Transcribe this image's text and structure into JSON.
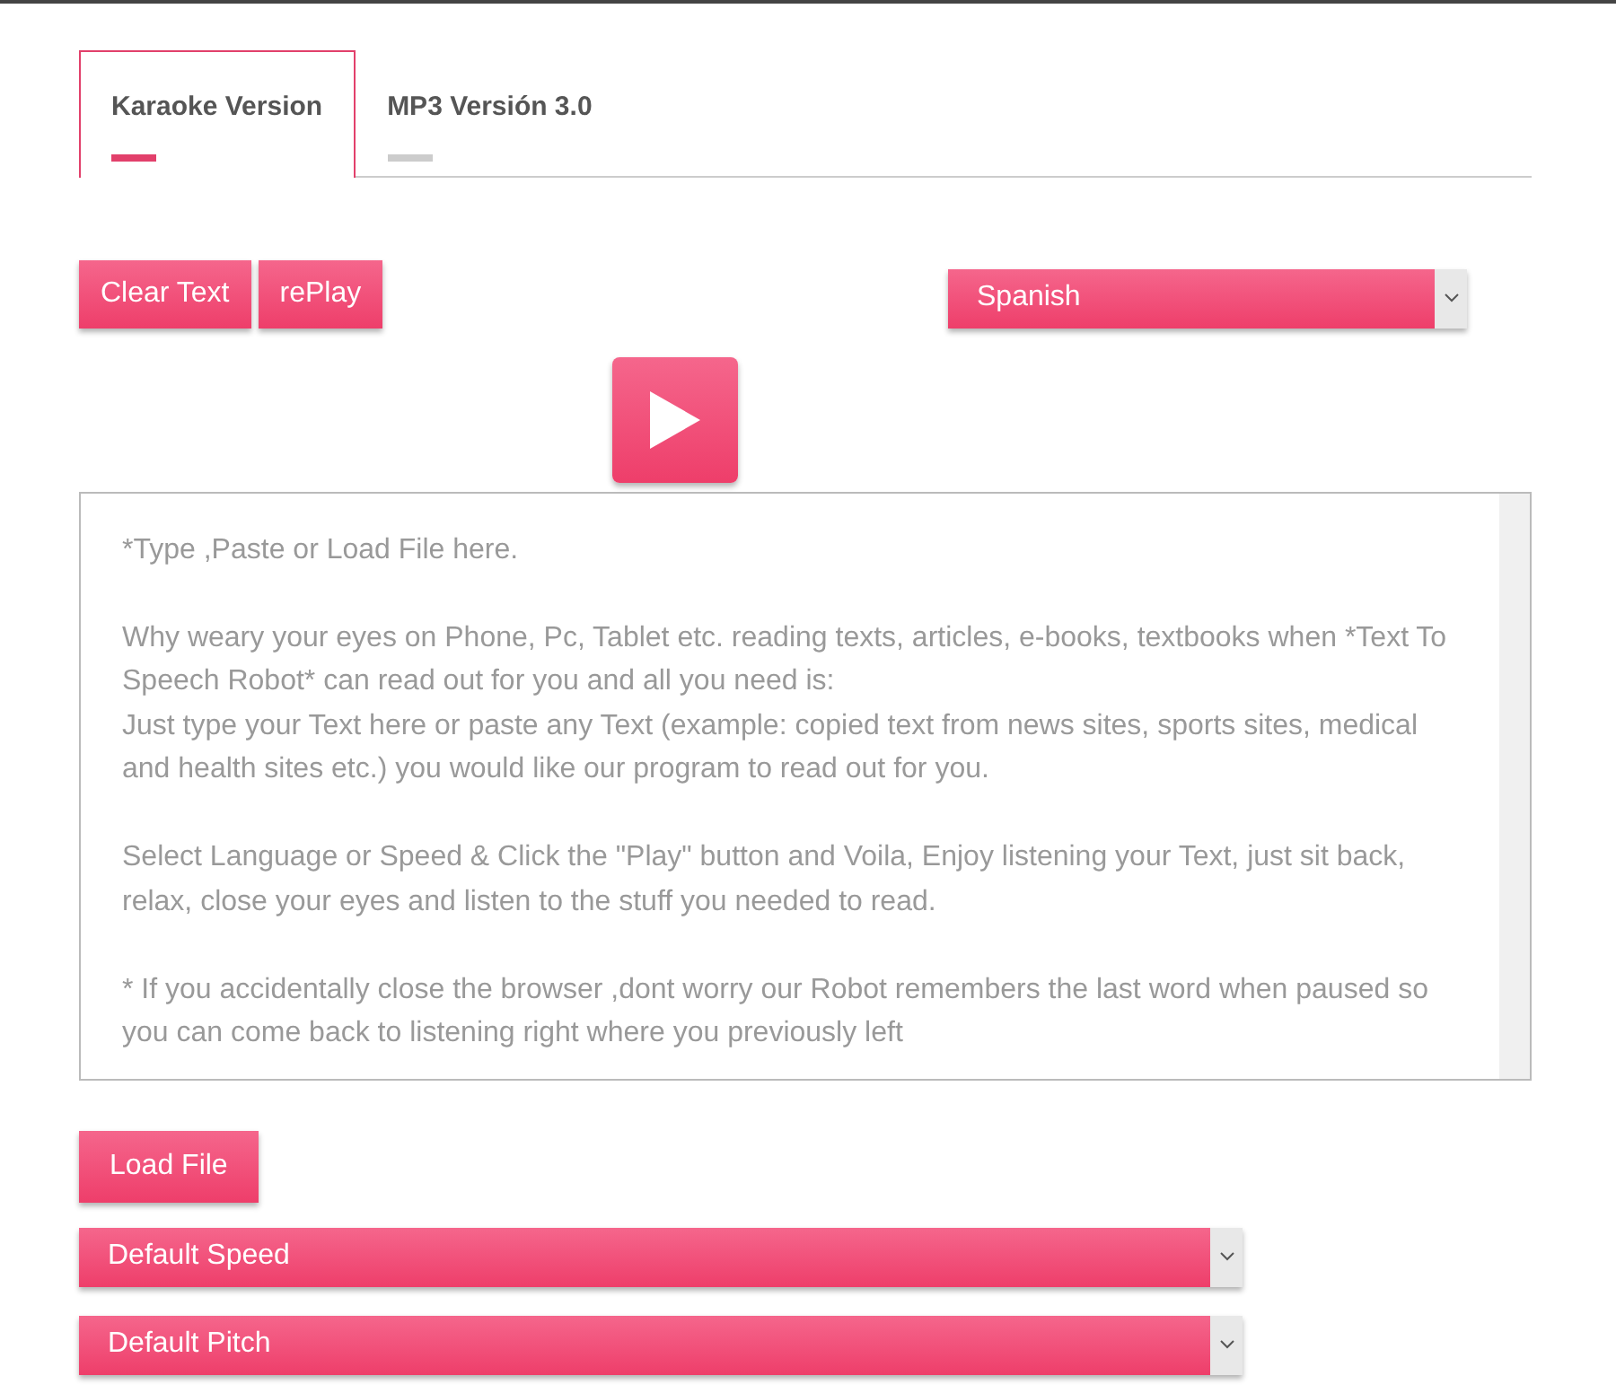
{
  "tabs": [
    {
      "label": "Karaoke Version",
      "selected": true
    },
    {
      "label": "MP3 Versión 3.0",
      "selected": false
    }
  ],
  "buttons": [
    "Clear Text",
    "rePlay"
  ],
  "language_select": {
    "value": "Spanish"
  },
  "text_area": {
    "paragraphs": [
      "*Type ,Paste or Load File here.",
      "Why weary your eyes on Phone, Pc, Tablet etc. reading texts, articles, e-books, textbooks when *Text To Speech Robot* can read out for you and all you need is:\nJust type your Text here or paste any Text (example: copied text from news sites, sports sites, medical and health sites etc.) you would like our program to read out for you.",
      "Select Language or Speed & Click the \"Play\" button and Voila, Enjoy listening your Text, just sit back, relax, close your eyes and listen to the stuff you needed to read.",
      "* If you accidentally close the browser ,dont worry our Robot remembers the last word when paused so you can come back to listening right where you previously left"
    ]
  },
  "load_button": "Load File",
  "speed_select": {
    "value": "Default Speed"
  },
  "pitch_select": {
    "value": "Default Pitch"
  }
}
